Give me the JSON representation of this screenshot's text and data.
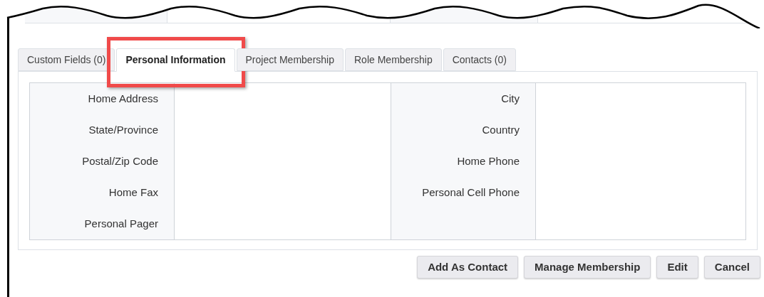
{
  "tabs": [
    {
      "label": "Custom Fields (0)",
      "selected": false,
      "highlighted": false
    },
    {
      "label": "Personal Information",
      "selected": true,
      "highlighted": true
    },
    {
      "label": "Project Membership",
      "selected": false,
      "highlighted": false
    },
    {
      "label": "Role Membership",
      "selected": false,
      "highlighted": false
    },
    {
      "label": "Contacts (0)",
      "selected": false,
      "highlighted": false
    }
  ],
  "rows": [
    {
      "left_label": "Home Address",
      "right_label": "City"
    },
    {
      "left_label": "State/Province",
      "right_label": "Country"
    },
    {
      "left_label": "Postal/Zip Code",
      "right_label": "Home Phone"
    },
    {
      "left_label": "Home Fax",
      "right_label": "Personal Cell Phone"
    },
    {
      "left_label": "Personal Pager"
    }
  ],
  "buttons": [
    "Add As Contact",
    "Manage Membership",
    "Edit",
    "Cancel"
  ]
}
